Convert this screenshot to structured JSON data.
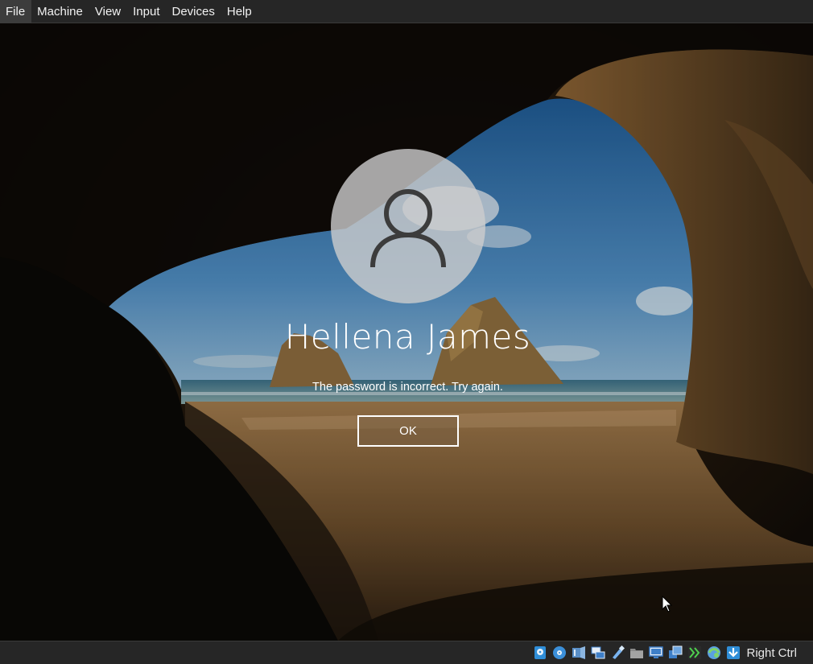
{
  "menubar": {
    "items": [
      "File",
      "Machine",
      "View",
      "Input",
      "Devices",
      "Help"
    ]
  },
  "login": {
    "user_name": "Hellena James",
    "message": "The password is incorrect. Try again.",
    "ok_label": "OK"
  },
  "statusbar": {
    "icons": [
      "hard-disk-icon",
      "optical-drive-icon",
      "audio-icon",
      "network-icon",
      "usb-icon",
      "shared-folders-icon",
      "display-icon",
      "recording-icon",
      "video-capture-icon",
      "cpu-activity-icon",
      "mouse-integration-icon",
      "keyboard-capture-icon"
    ],
    "host_key": "Right Ctrl"
  },
  "colors": {
    "chrome_bg": "#262626",
    "chrome_text": "#f2f2f2",
    "avatar_bg": "#cdcdcd",
    "ok_border": "#ffffff"
  }
}
